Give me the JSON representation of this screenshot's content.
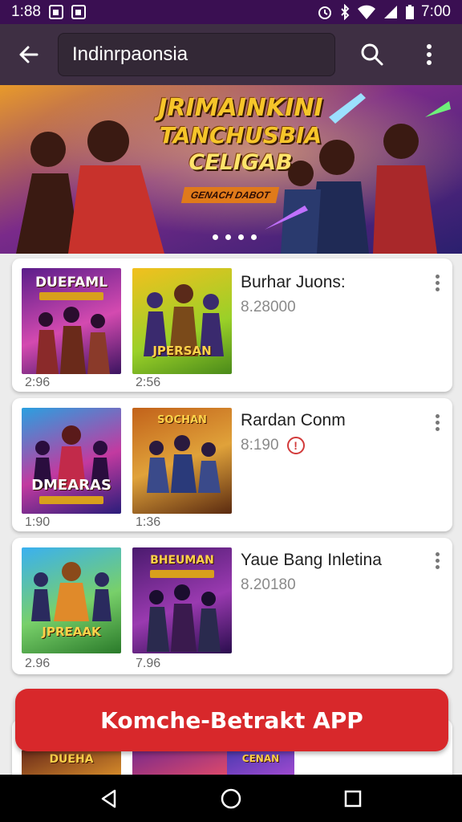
{
  "status_bar": {
    "time_left": "1:88",
    "time_right": "7:00",
    "icons": [
      "gallery-icon",
      "square-icon",
      "alarm-icon",
      "bluetooth-icon",
      "wifi-icon",
      "signal-icon",
      "battery-icon"
    ]
  },
  "app_bar": {
    "search_value": "Indinrpaonsia",
    "icons": [
      "back-arrow-icon",
      "search-icon",
      "more-vert-icon"
    ]
  },
  "banner": {
    "title_line1": "JRIMAINKINI",
    "title_line2": "TANCHUSBIA",
    "title_line3": "CELIGAB",
    "subtitle": "GENACH DABOT",
    "slide_count": 4
  },
  "cards": [
    {
      "title": "Burhar Juons:",
      "value": "8.28000",
      "alert": false,
      "thumbs": [
        {
          "label": "DUEFAML",
          "price": "2:96"
        },
        {
          "label": "JPERSAN",
          "price": "2:56"
        }
      ]
    },
    {
      "title": "Rardan Conm",
      "value": "8:190",
      "alert": true,
      "alert_glyph": "!",
      "thumbs": [
        {
          "label": "DMEARAS",
          "price": "1:90"
        },
        {
          "label": "SOCHAN",
          "price": "1:36"
        }
      ]
    },
    {
      "title": "Yaue Bang Inletina",
      "value": "8.20180",
      "alert": false,
      "thumbs": [
        {
          "label": "JPREAAK",
          "price": "2.96"
        },
        {
          "label": "BHEUMAN",
          "price": "7.96"
        }
      ]
    }
  ],
  "partial_card": {
    "thumb_labels": [
      "DUEHA",
      "",
      "CENAN"
    ]
  },
  "cta": {
    "label": "Komche-Betrakt APP"
  },
  "nav_bar": {
    "icons": [
      "back-triangle-icon",
      "home-circle-icon",
      "recents-square-icon"
    ]
  },
  "colors": {
    "status_bar": "#3a0f52",
    "app_bar": "#3e2f43",
    "cta": "#d8282b",
    "banner_title": "#f6c52a"
  }
}
